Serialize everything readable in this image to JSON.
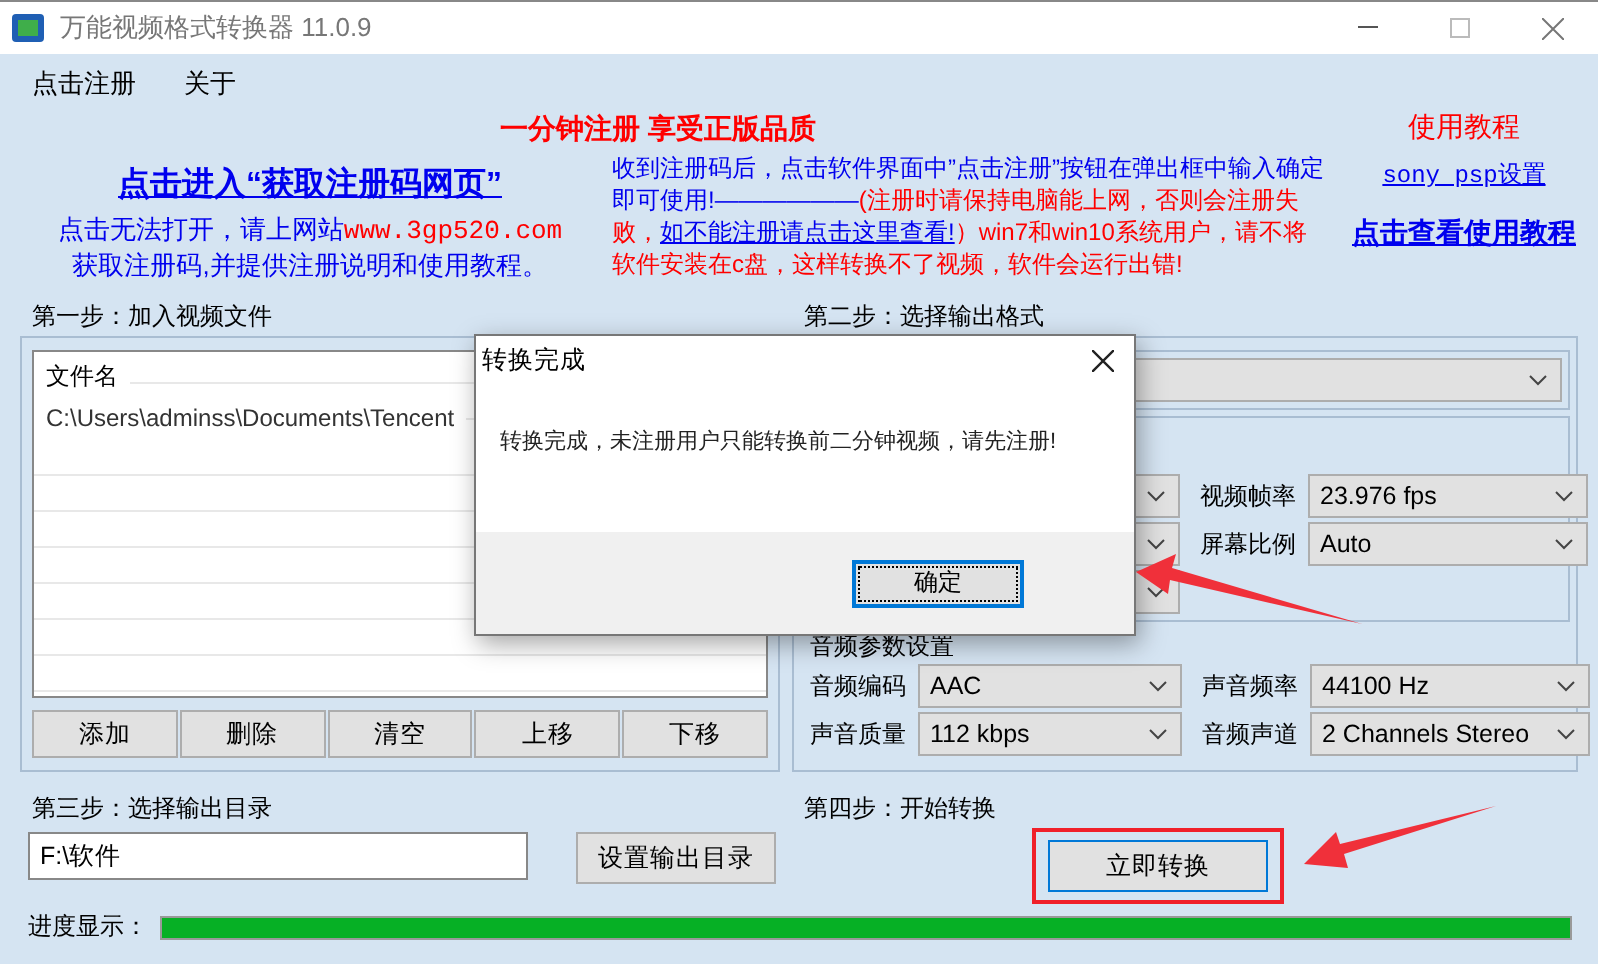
{
  "window": {
    "title": "万能视频格式转换器 11.0.9"
  },
  "menu": [
    "点击注册",
    "关于"
  ],
  "promo": {
    "headline": "一分钟注册  享受正版品质",
    "register_link": "点击进入“获取注册码网页”",
    "fallback": [
      {
        "kind": "plain",
        "text": "点击无法打开，请上网站"
      },
      {
        "kind": "url",
        "text": "www.3gp520.com"
      },
      {
        "kind": "plain",
        "text": "获取注册码,并提供注册说明和使用教程。"
      }
    ],
    "notice": [
      {
        "kind": "plain",
        "text": "收到注册码后，点击软件界面中”点击注册”按钮在弹出框中输入确定即可使用!——————"
      },
      {
        "kind": "warning",
        "text": "(注册时请保持电脑能上网，否则会注册失败，"
      },
      {
        "kind": "link",
        "text": "如不能注册请点击这里查看!"
      },
      {
        "kind": "warning",
        "text": "）win7和win10系统用户，请不将软件安装在c盘，这样转换不了视频，软件会运行出错!"
      }
    ]
  },
  "tutorial": {
    "title": "使用教程",
    "links": [
      {
        "kind": "small",
        "text": "sony psp设置"
      },
      {
        "kind": "large",
        "text": "点击查看使用教程"
      }
    ]
  },
  "step1": {
    "label": "第一步：加入视频文件",
    "column": "文件名",
    "files": [
      "C:\\Users\\adminss\\Documents\\Tencent"
    ],
    "buttons": [
      "添加",
      "删除",
      "清空",
      "上移",
      "下移"
    ]
  },
  "step2": {
    "label": "第二步：选择输出格式",
    "video_fields": [
      {
        "label": "视频帧率",
        "value": "23.976 fps"
      },
      {
        "label": "屏幕比例",
        "value": "Auto"
      }
    ],
    "audio_title": "音频参数设置",
    "audio_fields": [
      {
        "label": "音频编码",
        "value": "AAC"
      },
      {
        "label": "声音频率",
        "value": "44100 Hz"
      },
      {
        "label": "声音质量",
        "value": "112 kbps"
      },
      {
        "label": "音频声道",
        "value": "2 Channels Stereo"
      }
    ]
  },
  "step3": {
    "label": "第三步：选择输出目录",
    "path": "F:\\软件",
    "button": "设置输出目录"
  },
  "step4": {
    "label": "第四步：开始转换",
    "button": "立即转换"
  },
  "progress": {
    "label": "进度显示：",
    "level": 1
  },
  "dialog": {
    "title": "转换完成",
    "message": "转换完成，未注册用户只能转换前二分钟视频，请先注册!",
    "button": "确定"
  }
}
